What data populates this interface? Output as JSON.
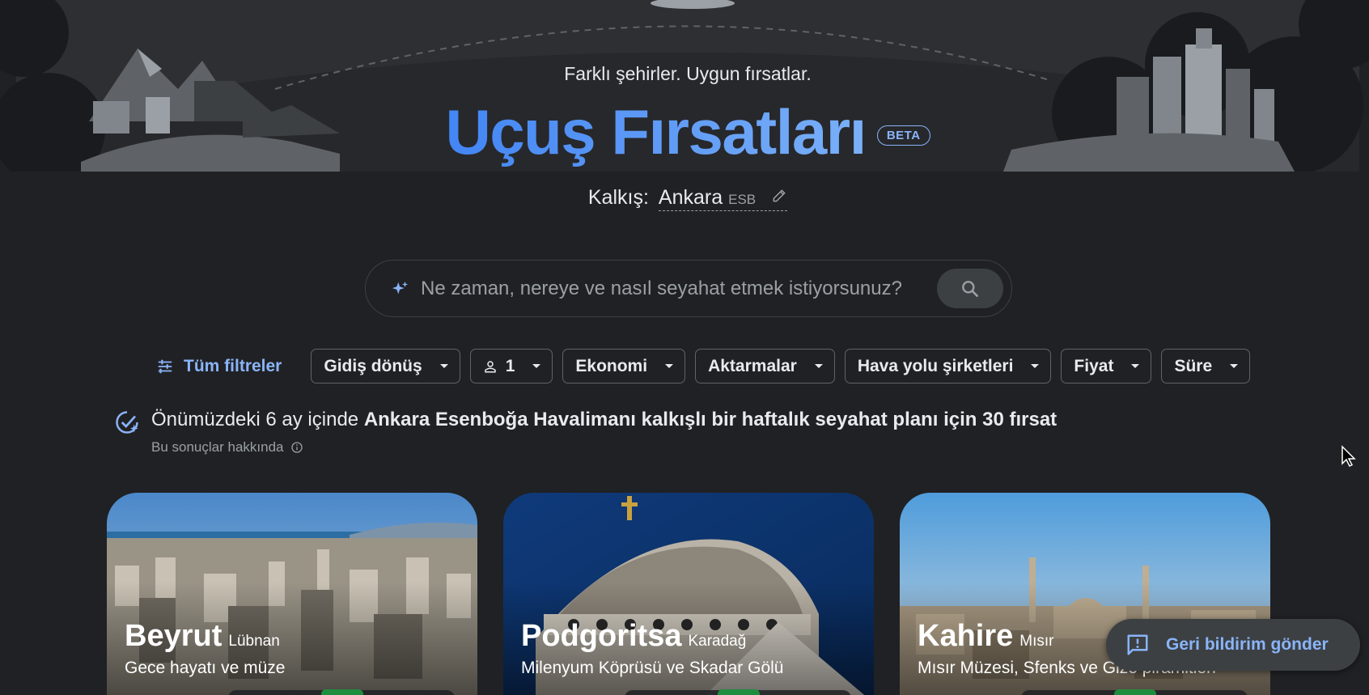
{
  "hero": {
    "tagline": "Farklı şehirler. Uygun fırsatlar.",
    "title": "Uçuş Fırsatları",
    "badge": "BETA"
  },
  "origin": {
    "label": "Kalkış:",
    "city": "Ankara",
    "code": "ESB"
  },
  "search": {
    "placeholder": "Ne zaman, nereye ve nasıl seyahat etmek istiyorsunuz?"
  },
  "filters": {
    "all_label": "Tüm filtreler",
    "chips": [
      "Gidiş dönüş",
      "1",
      "Ekonomi",
      "Aktarmalar",
      "Hava yolu şirketleri",
      "Fiyat",
      "Süre"
    ]
  },
  "summary": {
    "prefix": "Önümüzdeki 6 ay içinde ",
    "highlight": "Ankara Esenboğa Havalimanı kalkışlı bir haftalık seyahat planı için 30 fırsat",
    "about": "Bu sonuçlar hakkında"
  },
  "cards": [
    {
      "city": "Beyrut",
      "country": "Lübnan",
      "desc": "Gece hayatı ve müze"
    },
    {
      "city": "Podgoritsa",
      "country": "Karadağ",
      "desc": "Milenyum Köprüsü ve Skadar Gölü"
    },
    {
      "city": "Kahire",
      "country": "Mısır",
      "desc": "Mısır Müzesi, Sfenks ve Gize piramitleri"
    }
  ],
  "feedback": {
    "label": "Geri bildirim gönder"
  },
  "colors": {
    "background": "#202124",
    "accent": "#8ab4f8",
    "title_blue": "#4285f4"
  }
}
